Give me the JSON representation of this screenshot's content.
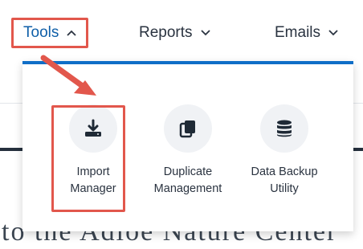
{
  "nav": {
    "tools_label": "Tools",
    "reports_label": "Reports",
    "emails_label": "Emails"
  },
  "menu": {
    "items": [
      {
        "line1": "Import",
        "line2": "Manager",
        "icon": "download-icon"
      },
      {
        "line1": "Duplicate",
        "line2": "Management",
        "icon": "duplicate-icon"
      },
      {
        "line1": "Data Backup",
        "line2": "Utility",
        "icon": "database-icon"
      }
    ]
  },
  "background": {
    "heading_fragment": "to the Adloe Nature Center"
  },
  "colors": {
    "accent_blue": "#0f6ec7",
    "tools_text": "#0f5fa8",
    "annotation_red": "#e2574c",
    "icon_dark": "#1f2a36",
    "icon_bg": "#f0f2f5"
  }
}
